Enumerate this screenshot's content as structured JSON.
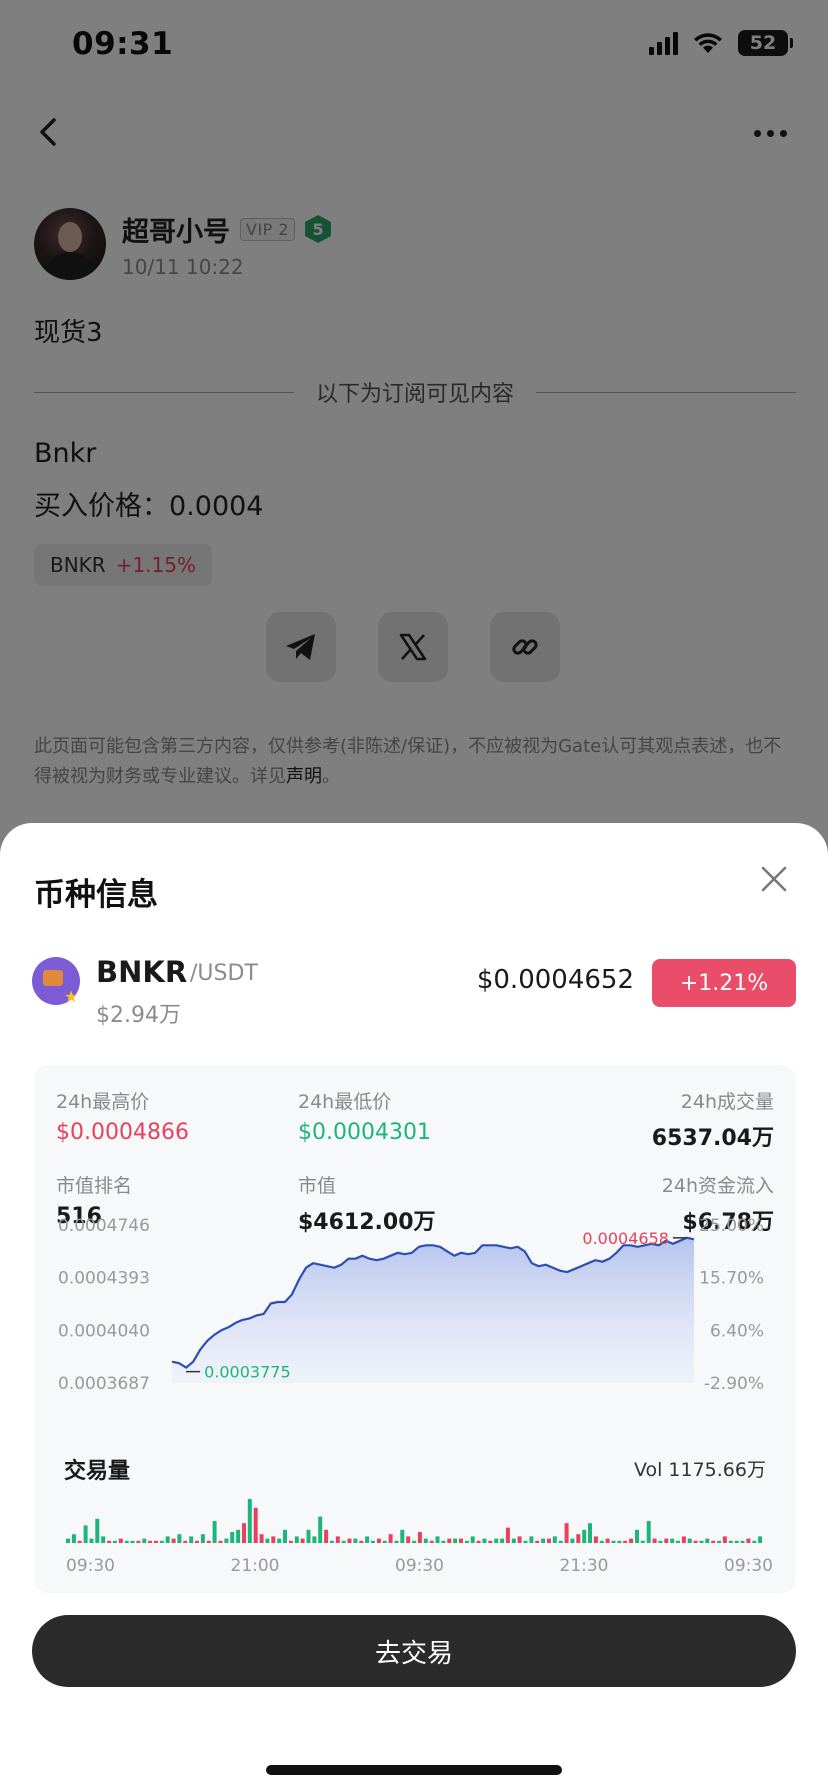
{
  "status": {
    "time": "09:31",
    "battery": "52"
  },
  "post": {
    "author_name": "超哥小号",
    "vip": "VIP 2",
    "level": "5",
    "time": "10/11 10:22",
    "title": "现货3",
    "divider": "以下为订阅可见内容",
    "line1": "Bnkr",
    "line2": "买入价格：0.0004",
    "tag_symbol": "BNKR",
    "tag_change": "+1.15%",
    "disclaimer_text": "此页面可能包含第三方内容，仅供参考(非陈述/保证)，不应被视为Gate认可其观点表述，也不得被视为财务或专业建议。详见",
    "disclaimer_link": "声明",
    "disclaimer_end": "。"
  },
  "sheet": {
    "title": "币种信息",
    "coin": {
      "symbol": "BNKR",
      "pair": "/USDT",
      "market_cap": "$2.94万",
      "price": "$0.0004652",
      "change": "+1.21%"
    },
    "stats": [
      {
        "label": "24h最高价",
        "value": "$0.0004866"
      },
      {
        "label": "24h最低价",
        "value": "$0.0004301"
      },
      {
        "label": "24h成交量",
        "value": "6537.04万"
      },
      {
        "label": "市值排名",
        "value": "516"
      },
      {
        "label": "市值",
        "value": "$4612.00万"
      },
      {
        "label": "24h资金流入",
        "value": "$6.78万"
      }
    ],
    "volume_title": "交易量",
    "volume_total": "Vol 1175.66万",
    "trade_button": "去交易"
  },
  "colors": {
    "up": "#e8415c",
    "down": "#1db67a",
    "line": "#2d4fb2"
  },
  "chart_data": [
    {
      "type": "area",
      "title": "",
      "y_left_ticks": [
        "0.0004746",
        "0.0004393",
        "0.0004040",
        "0.0003687"
      ],
      "y_right_ticks": [
        "25.00%",
        "15.70%",
        "6.40%",
        "-2.90%"
      ],
      "ylim": [
        0.0003687,
        0.0004746
      ],
      "annotations": {
        "high": "0.0004658",
        "low": "0.0003775"
      },
      "series": [
        {
          "values": [
            0.000383,
            0.000382,
            0.000379,
            0.000383,
            0.000391,
            0.000397,
            0.000401,
            0.000404,
            0.000406,
            0.000409,
            0.000411,
            0.000412,
            0.000414,
            0.000415,
            0.000422,
            0.000423,
            0.000423,
            0.000428,
            0.000438,
            0.000446,
            0.000449,
            0.000448,
            0.000447,
            0.000446,
            0.000448,
            0.000452,
            0.000452,
            0.000454,
            0.000452,
            0.000451,
            0.000452,
            0.000454,
            0.000456,
            0.000455,
            0.000456,
            0.00046,
            0.000461,
            0.000461,
            0.00046,
            0.000457,
            0.000454,
            0.000456,
            0.000455,
            0.000456,
            0.000461,
            0.000461,
            0.000461,
            0.00046,
            0.000459,
            0.00046,
            0.000457,
            0.000449,
            0.000447,
            0.000448,
            0.000446,
            0.000444,
            0.000443,
            0.000445,
            0.000447,
            0.000449,
            0.000451,
            0.00045,
            0.000452,
            0.000456,
            0.000461,
            0.000461,
            0.00046,
            0.000461,
            0.000462,
            0.000461,
            0.000464,
            0.000462,
            0.000464,
            0.000466,
            0.000465
          ]
        }
      ]
    },
    {
      "type": "bar",
      "title": "交易量",
      "x_ticks": [
        "09:30",
        "21:00",
        "09:30",
        "21:30",
        "09:30"
      ],
      "values": [
        2,
        4,
        1,
        8,
        2,
        11,
        3,
        1,
        1,
        2,
        1,
        1,
        1,
        2,
        1,
        1,
        1,
        3,
        2,
        4,
        1,
        3,
        1,
        4,
        1,
        10,
        1,
        2,
        5,
        6,
        9,
        20,
        16,
        4,
        2,
        3,
        2,
        6,
        1,
        3,
        2,
        6,
        3,
        12,
        6,
        1,
        3,
        1,
        2,
        2,
        1,
        3,
        1,
        2,
        1,
        4,
        1,
        6,
        3,
        1,
        5,
        2,
        1,
        3,
        1,
        2,
        2,
        2,
        1,
        3,
        1,
        2,
        1,
        2,
        2,
        7,
        2,
        3,
        1,
        3,
        1,
        2,
        2,
        3,
        1,
        9,
        2,
        4,
        6,
        9,
        3,
        1,
        2,
        1,
        1,
        1,
        2,
        6,
        1,
        10,
        2,
        1,
        2,
        2,
        1,
        3,
        2,
        1,
        1,
        2,
        1,
        1,
        3,
        1,
        1,
        1,
        2,
        1,
        3
      ],
      "up": [
        true,
        true,
        false,
        true,
        true,
        true,
        true,
        false,
        true,
        false,
        true,
        true,
        false,
        true,
        false,
        false,
        true,
        true,
        false,
        true,
        false,
        true,
        false,
        true,
        false,
        true,
        false,
        true,
        true,
        true,
        false,
        true,
        false,
        false,
        true,
        false,
        true,
        true,
        false,
        true,
        false,
        true,
        true,
        true,
        false,
        true,
        false,
        true,
        false,
        true,
        false,
        true,
        true,
        false,
        true,
        false,
        true,
        true,
        false,
        true,
        false,
        true,
        false,
        true,
        true,
        false,
        true,
        false,
        true,
        true,
        false,
        true,
        false,
        true,
        true,
        false,
        true,
        false,
        true,
        true,
        false,
        true,
        false,
        true,
        true,
        false,
        true,
        false,
        true,
        true,
        false,
        true,
        false,
        true,
        true,
        false,
        false,
        true,
        true,
        true,
        false,
        true,
        false,
        true,
        true,
        false,
        true,
        false,
        true,
        true,
        false,
        true,
        false,
        true,
        true,
        true,
        false,
        true,
        true
      ]
    }
  ]
}
